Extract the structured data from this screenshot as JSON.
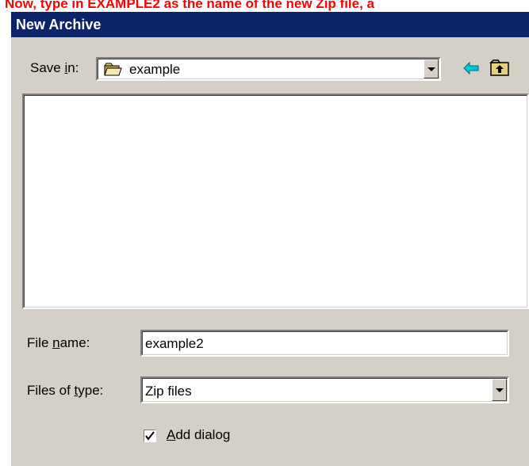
{
  "instruction": "Now, type in EXAMPLE2 as the name of the new Zip file, a",
  "dialog": {
    "title": "New Archive",
    "save_in_label": "Save in:",
    "save_in_value": "example",
    "file_name_label": "File name:",
    "file_name_value": "example2",
    "files_of_type_label": "Files of type:",
    "files_of_type_value": "Zip files",
    "add_dialog_label": "Add dialog",
    "add_dialog_checked": true
  },
  "icons": [
    "folder-icon",
    "back-arrow-icon",
    "up-folder-icon",
    "chevron-down-icon",
    "checkmark-icon"
  ],
  "colors": {
    "caption": "#ff0000",
    "titlebar": "#0a246a",
    "dialog_bg": "#d4d0c8",
    "back_arrow": "#00c8d8"
  }
}
